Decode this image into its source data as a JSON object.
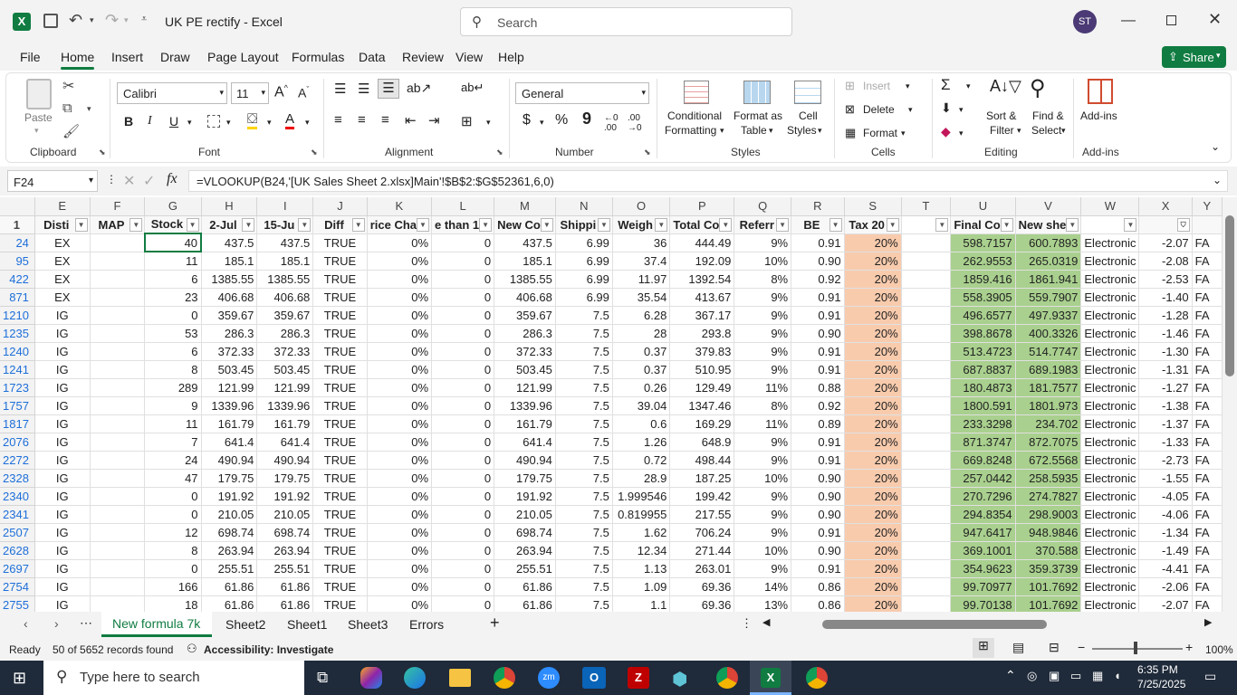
{
  "titlebar": {
    "doc_title": "UK PE rectify  -  Excel",
    "search_placeholder": "Search",
    "user_initials": "ST"
  },
  "tabs": [
    "File",
    "Home",
    "Insert",
    "Draw",
    "Page Layout",
    "Formulas",
    "Data",
    "Review",
    "View",
    "Help"
  ],
  "share_label": "Share",
  "ribbon": {
    "paste": "Paste",
    "clipboard": "Clipboard",
    "font_name": "Calibri",
    "font_size": "11",
    "font": "Font",
    "alignment": "Alignment",
    "number_format": "General",
    "number": "Number",
    "conditional_1": "Conditional",
    "conditional_2": "Formatting",
    "format_as_1": "Format as",
    "format_as_2": "Table",
    "cell_styles_1": "Cell",
    "cell_styles_2": "Styles",
    "styles": "Styles",
    "insert": "Insert",
    "delete": "Delete",
    "format": "Format",
    "cells": "Cells",
    "sort_1": "Sort &",
    "sort_2": "Filter",
    "find_1": "Find &",
    "find_2": "Select",
    "editing": "Editing",
    "addins": "Add-ins",
    "addins_group": "Add-ins"
  },
  "formula_bar": {
    "name_box": "F24",
    "formula": "=VLOOKUP(B24,'[UK Sales Sheet 2.xlsx]Main'!$B$2:$G$52361,6,0)"
  },
  "columns": [
    "E",
    "F",
    "G",
    "H",
    "I",
    "J",
    "K",
    "L",
    "M",
    "N",
    "O",
    "P",
    "Q",
    "R",
    "S",
    "T",
    "U",
    "V",
    "W",
    "X",
    "Y"
  ],
  "headers": [
    "Disti",
    "MAP",
    "Stock",
    "2-Jul",
    "15-Ju",
    "Diff",
    "rice Cha",
    "e than 1",
    "New Co",
    "Shippi",
    "Weigh",
    "Total Co",
    "Referr",
    "BE",
    "Tax 20",
    "",
    "Final Co",
    "New she",
    "",
    "",
    ""
  ],
  "rows": [
    [
      "24",
      "EX",
      "",
      "40",
      "437.5",
      "437.5",
      "TRUE",
      "0%",
      "0",
      "437.5",
      "6.99",
      "36",
      "444.49",
      "9%",
      "0.91",
      "20%",
      "",
      "598.7157",
      "600.7893",
      "Electronic",
      "-2.07",
      "FA"
    ],
    [
      "95",
      "EX",
      "",
      "11",
      "185.1",
      "185.1",
      "TRUE",
      "0%",
      "0",
      "185.1",
      "6.99",
      "37.4",
      "192.09",
      "10%",
      "0.90",
      "20%",
      "",
      "262.9553",
      "265.0319",
      "Electronic",
      "-2.08",
      "FA"
    ],
    [
      "422",
      "EX",
      "",
      "6",
      "1385.55",
      "1385.55",
      "TRUE",
      "0%",
      "0",
      "1385.55",
      "6.99",
      "11.97",
      "1392.54",
      "8%",
      "0.92",
      "20%",
      "",
      "1859.416",
      "1861.941",
      "Electronic",
      "-2.53",
      "FA"
    ],
    [
      "871",
      "EX",
      "",
      "23",
      "406.68",
      "406.68",
      "TRUE",
      "0%",
      "0",
      "406.68",
      "6.99",
      "35.54",
      "413.67",
      "9%",
      "0.91",
      "20%",
      "",
      "558.3905",
      "559.7907",
      "Electronic",
      "-1.40",
      "FA"
    ],
    [
      "1210",
      "IG",
      "",
      "0",
      "359.67",
      "359.67",
      "TRUE",
      "0%",
      "0",
      "359.67",
      "7.5",
      "6.28",
      "367.17",
      "9%",
      "0.91",
      "20%",
      "",
      "496.6577",
      "497.9337",
      "Electronic",
      "-1.28",
      "FA"
    ],
    [
      "1235",
      "IG",
      "",
      "53",
      "286.3",
      "286.3",
      "TRUE",
      "0%",
      "0",
      "286.3",
      "7.5",
      "28",
      "293.8",
      "9%",
      "0.90",
      "20%",
      "",
      "398.8678",
      "400.3326",
      "Electronic",
      "-1.46",
      "FA"
    ],
    [
      "1240",
      "IG",
      "",
      "6",
      "372.33",
      "372.33",
      "TRUE",
      "0%",
      "0",
      "372.33",
      "7.5",
      "0.37",
      "379.83",
      "9%",
      "0.91",
      "20%",
      "",
      "513.4723",
      "514.7747",
      "Electronic",
      "-1.30",
      "FA"
    ],
    [
      "1241",
      "IG",
      "",
      "8",
      "503.45",
      "503.45",
      "TRUE",
      "0%",
      "0",
      "503.45",
      "7.5",
      "0.37",
      "510.95",
      "9%",
      "0.91",
      "20%",
      "",
      "687.8837",
      "689.1983",
      "Electronic",
      "-1.31",
      "FA"
    ],
    [
      "1723",
      "IG",
      "",
      "289",
      "121.99",
      "121.99",
      "TRUE",
      "0%",
      "0",
      "121.99",
      "7.5",
      "0.26",
      "129.49",
      "11%",
      "0.88",
      "20%",
      "",
      "180.4873",
      "181.7577",
      "Electronic",
      "-1.27",
      "FA"
    ],
    [
      "1757",
      "IG",
      "",
      "9",
      "1339.96",
      "1339.96",
      "TRUE",
      "0%",
      "0",
      "1339.96",
      "7.5",
      "39.04",
      "1347.46",
      "8%",
      "0.92",
      "20%",
      "",
      "1800.591",
      "1801.973",
      "Electronic",
      "-1.38",
      "FA"
    ],
    [
      "1817",
      "IG",
      "",
      "11",
      "161.79",
      "161.79",
      "TRUE",
      "0%",
      "0",
      "161.79",
      "7.5",
      "0.6",
      "169.29",
      "11%",
      "0.89",
      "20%",
      "",
      "233.3298",
      "234.702",
      "Electronic",
      "-1.37",
      "FA"
    ],
    [
      "2076",
      "IG",
      "",
      "7",
      "641.4",
      "641.4",
      "TRUE",
      "0%",
      "0",
      "641.4",
      "7.5",
      "1.26",
      "648.9",
      "9%",
      "0.91",
      "20%",
      "",
      "871.3747",
      "872.7075",
      "Electronic",
      "-1.33",
      "FA"
    ],
    [
      "2272",
      "IG",
      "",
      "24",
      "490.94",
      "490.94",
      "TRUE",
      "0%",
      "0",
      "490.94",
      "7.5",
      "0.72",
      "498.44",
      "9%",
      "0.91",
      "20%",
      "",
      "669.8248",
      "672.5568",
      "Electronic",
      "-2.73",
      "FA"
    ],
    [
      "2328",
      "IG",
      "",
      "47",
      "179.75",
      "179.75",
      "TRUE",
      "0%",
      "0",
      "179.75",
      "7.5",
      "28.9",
      "187.25",
      "10%",
      "0.90",
      "20%",
      "",
      "257.0442",
      "258.5935",
      "Electronic",
      "-1.55",
      "FA"
    ],
    [
      "2340",
      "IG",
      "",
      "0",
      "191.92",
      "191.92",
      "TRUE",
      "0%",
      "0",
      "191.92",
      "7.5",
      "1.999546",
      "199.42",
      "9%",
      "0.90",
      "20%",
      "",
      "270.7296",
      "274.7827",
      "Electronic",
      "-4.05",
      "FA"
    ],
    [
      "2341",
      "IG",
      "",
      "0",
      "210.05",
      "210.05",
      "TRUE",
      "0%",
      "0",
      "210.05",
      "7.5",
      "0.819955",
      "217.55",
      "9%",
      "0.90",
      "20%",
      "",
      "294.8354",
      "298.9003",
      "Electronic",
      "-4.06",
      "FA"
    ],
    [
      "2507",
      "IG",
      "",
      "12",
      "698.74",
      "698.74",
      "TRUE",
      "0%",
      "0",
      "698.74",
      "7.5",
      "1.62",
      "706.24",
      "9%",
      "0.91",
      "20%",
      "",
      "947.6417",
      "948.9846",
      "Electronic",
      "-1.34",
      "FA"
    ],
    [
      "2628",
      "IG",
      "",
      "8",
      "263.94",
      "263.94",
      "TRUE",
      "0%",
      "0",
      "263.94",
      "7.5",
      "12.34",
      "271.44",
      "10%",
      "0.90",
      "20%",
      "",
      "369.1001",
      "370.588",
      "Electronic",
      "-1.49",
      "FA"
    ],
    [
      "2697",
      "IG",
      "",
      "0",
      "255.51",
      "255.51",
      "TRUE",
      "0%",
      "0",
      "255.51",
      "7.5",
      "1.13",
      "263.01",
      "9%",
      "0.91",
      "20%",
      "",
      "354.9623",
      "359.3739",
      "Electronic",
      "-4.41",
      "FA"
    ],
    [
      "2754",
      "IG",
      "",
      "166",
      "61.86",
      "61.86",
      "TRUE",
      "0%",
      "0",
      "61.86",
      "7.5",
      "1.09",
      "69.36",
      "14%",
      "0.86",
      "20%",
      "",
      "99.70977",
      "101.7692",
      "Electronic",
      "-2.06",
      "FA"
    ],
    [
      "2755",
      "IG",
      "",
      "18",
      "61.86",
      "61.86",
      "TRUE",
      "0%",
      "0",
      "61.86",
      "7.5",
      "1.1",
      "69.36",
      "13%",
      "0.86",
      "20%",
      "",
      "99.70138",
      "101.7692",
      "Electronic",
      "-2.07",
      "FA"
    ]
  ],
  "sheets": [
    "New formula 7k",
    "Sheet2",
    "Sheet1",
    "Sheet3",
    "Errors"
  ],
  "status": {
    "ready": "Ready",
    "records": "50 of 5652 records found",
    "accessibility": "Accessibility: Investigate",
    "zoom": "100%"
  },
  "taskbar": {
    "search_placeholder": "Type here to search",
    "time": "6:35 PM",
    "date": "7/25/2025"
  },
  "colors": {
    "excel_green": "#107c41",
    "orange_fill": "#f8cbad",
    "green_fill": "#a9d08e"
  }
}
